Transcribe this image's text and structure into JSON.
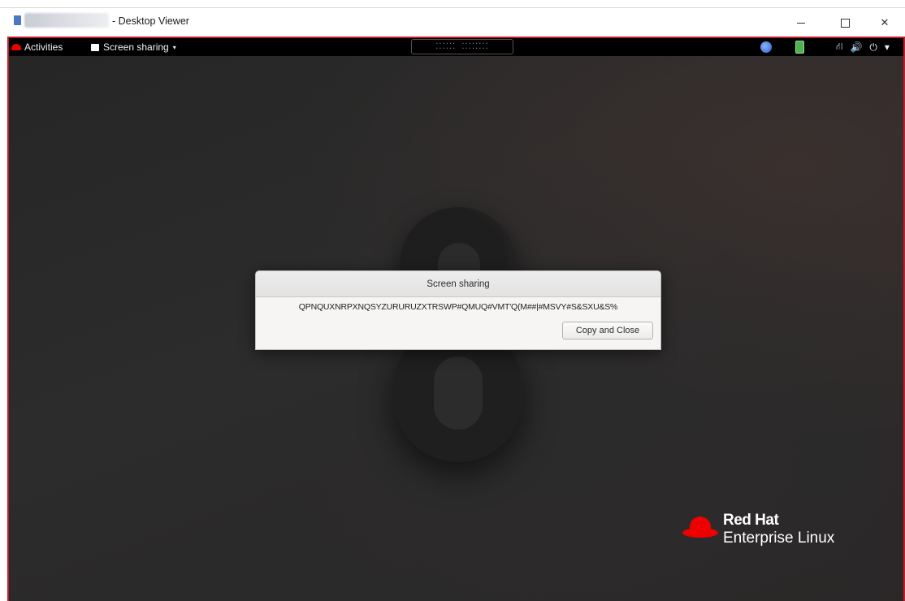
{
  "window": {
    "title": "- Desktop Viewer",
    "min_symbol": "",
    "close_symbol": "✕"
  },
  "topbar": {
    "activities": "Activities",
    "screen_sharing": "Screen sharing",
    "caret": "▾",
    "clock": "⁚⁚⁚⁚⁚⁚ ⁚⁚⁚⁚⁚⁚⁚⁚",
    "tray_network": "⛙",
    "tray_volume": "🔊",
    "tray_power": "⏻",
    "tray_caret": "▾"
  },
  "dialog": {
    "title": "Screen sharing",
    "code": "QPNQUXNRPXNQSYZURURUZXTRSWP#QMUQ#VMT'Q(M##|#MSVY#S&SXU&S%",
    "button": "Copy and Close"
  },
  "branding": {
    "line1": "Red Hat",
    "line2": "Enterprise Linux",
    "accent": "#ee0000"
  },
  "colors": {
    "guest_border": "#c01c28",
    "desktop_bg": "#2b2b2b"
  }
}
